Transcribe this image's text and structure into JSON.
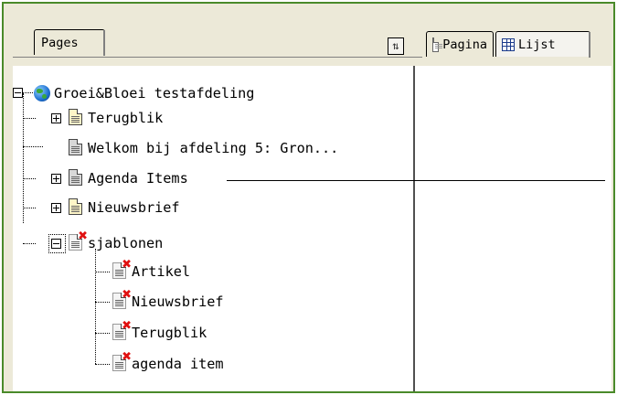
{
  "tabs": {
    "pages": "Pages",
    "pagina": "Pagina",
    "lijst": "Lijst"
  },
  "icons": {
    "refresh": "refresh-icon",
    "globe": "globe-icon",
    "page": "page-icon",
    "template": "template-page-icon"
  },
  "tree": {
    "root": "Groei&Bloei testafdeling",
    "items": [
      "Terugblik",
      "Welkom bij afdeling 5: Gron...",
      "Agenda Items",
      "Nieuwsbrief",
      "sjablonen"
    ],
    "templates": [
      "Artikel",
      "Nieuwsbrief",
      "Terugblik",
      "agenda item"
    ]
  },
  "colors": {
    "frame_border": "#4a8a2a",
    "chrome": "#ece9d8",
    "error_mark": "#e01010"
  }
}
